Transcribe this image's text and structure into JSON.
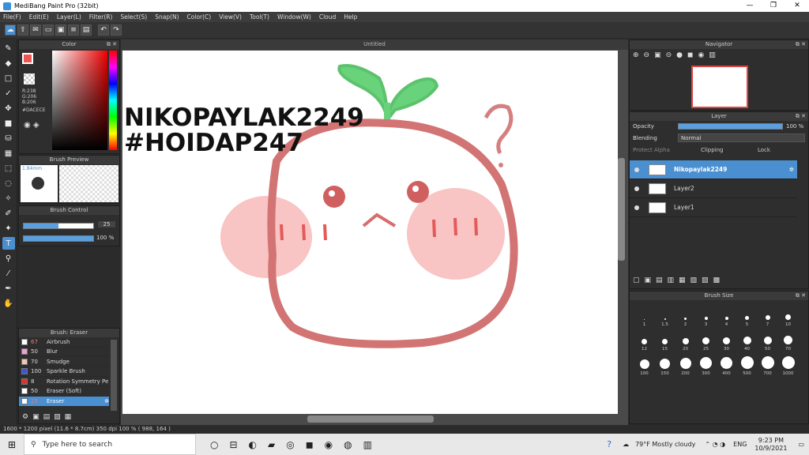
{
  "window": {
    "title": "MediBang Paint Pro (32bit)",
    "minimize": "—",
    "maximize": "❐",
    "close": "✕"
  },
  "menu": [
    "File(F)",
    "Edit(E)",
    "Layer(L)",
    "Filter(R)",
    "Select(S)",
    "Snap(N)",
    "Color(C)",
    "View(V)",
    "Tool(T)",
    "Window(W)",
    "Cloud",
    "Help"
  ],
  "panels": {
    "color": "Color",
    "brush_preview": "Brush Preview",
    "brush_control": "Brush Control",
    "brush_list": "Brush: Eraser",
    "navigator": "Navigator",
    "layer": "Layer",
    "brush_size": "Brush Size"
  },
  "color": {
    "r": "R:238",
    "g": "G:206",
    "b": "B:206",
    "hex": "#DACECE"
  },
  "brush_preview": {
    "size": "1.84mm"
  },
  "brush_control": {
    "size_value": "25",
    "opacity_value": "100 %"
  },
  "brushes": [
    {
      "num": "67",
      "name": "Airbrush",
      "color": "#ffffff"
    },
    {
      "num": "50",
      "name": "Blur",
      "color": "#f0a0d0"
    },
    {
      "num": "70",
      "name": "Smudge",
      "color": "#f7c6b0"
    },
    {
      "num": "100",
      "name": "Sparkle Brush",
      "color": "#3b57d8"
    },
    {
      "num": "8",
      "name": "Rotation Symmetry Pe",
      "color": "#e03030"
    },
    {
      "num": "50",
      "name": "Eraser (Soft)",
      "color": "#ffffff"
    },
    {
      "num": "25",
      "name": "Eraser",
      "color": "#ffffff"
    }
  ],
  "canvas": {
    "tab": "Untitled",
    "line1": "NIKOPAYLAK2249",
    "line2": "#HOIDAP247",
    "question": "?"
  },
  "layer": {
    "opacity_label": "Opacity",
    "opacity_value": "100 %",
    "blending_label": "Blending",
    "blending_value": "Normal",
    "protect_alpha": "Protect Alpha",
    "clipping": "Clipping",
    "lock": "Lock",
    "layers": [
      {
        "name": "Nikopaylak2249",
        "selected": true
      },
      {
        "name": "Layer2",
        "selected": false
      },
      {
        "name": "Layer1",
        "selected": false
      }
    ]
  },
  "brush_sizes": [
    "1",
    "1.5",
    "2",
    "3",
    "4",
    "5",
    "7",
    "10",
    "12",
    "15",
    "20",
    "25",
    "30",
    "40",
    "50",
    "70",
    "100",
    "150",
    "200",
    "300",
    "400",
    "500",
    "700",
    "1000"
  ],
  "status": "1600 * 1200 pixel   (11.6 * 8.7cm)  350 dpi  100 %   ( 988, 164 )",
  "taskbar": {
    "search_placeholder": "Type here to search",
    "weather": "79°F  Mostly cloudy",
    "lang": "ENG",
    "time": "9:23 PM",
    "date": "10/9/2021"
  }
}
